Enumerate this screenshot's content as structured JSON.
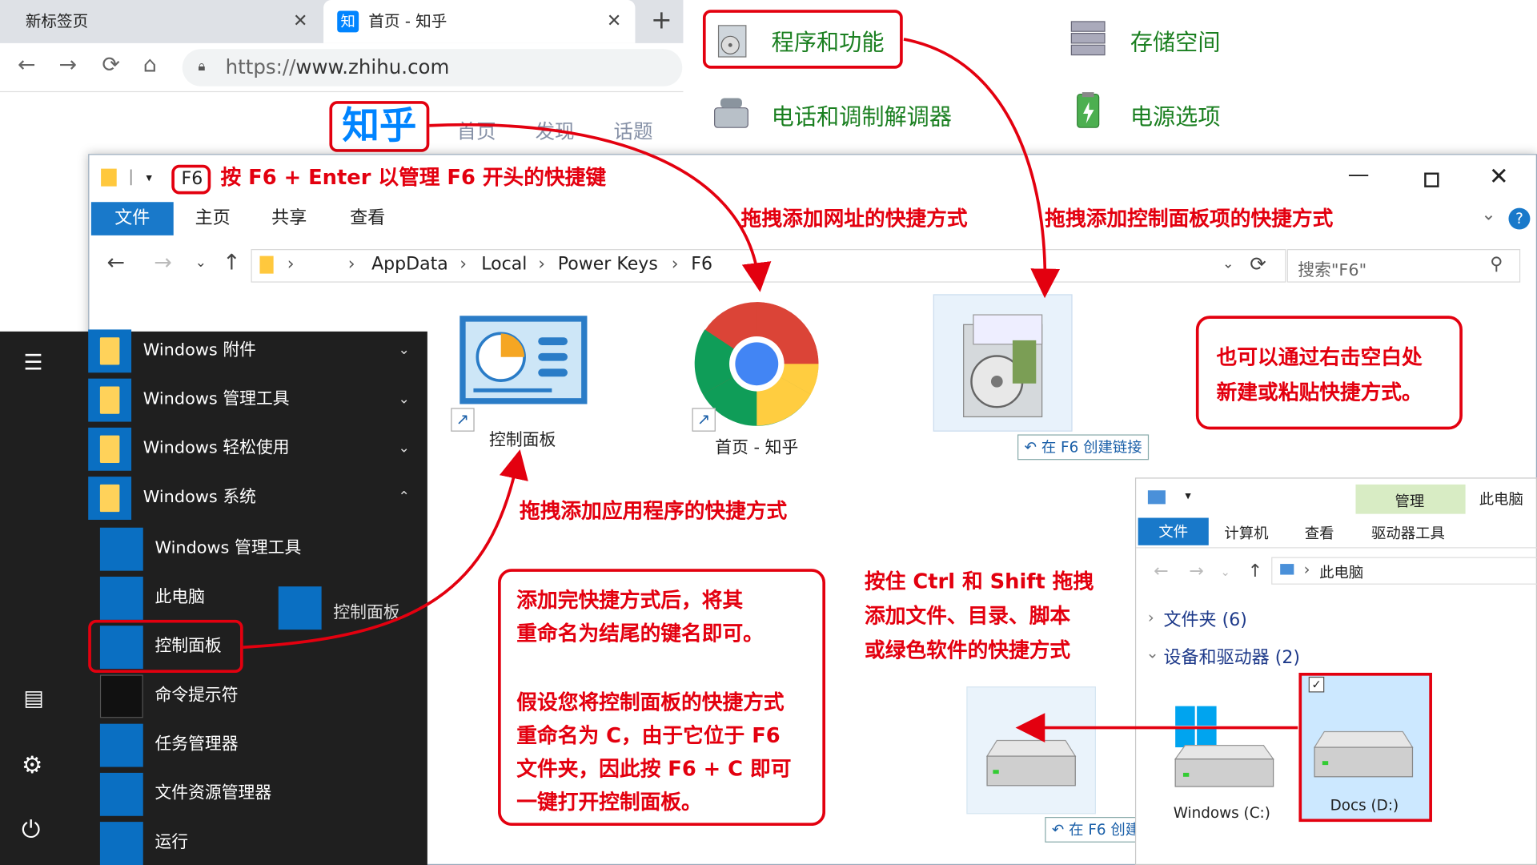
{
  "browser": {
    "tab1_title": "新标签页",
    "tab2_title": "首页 - 知乎",
    "tab2_favicon": "知",
    "new_tab": "+",
    "url_scheme": "https://",
    "url_host": "www.zhihu.com",
    "zhihu_logo": "知乎",
    "zhihu_nav": [
      "首页",
      "发现",
      "话题"
    ],
    "close_glyph": "✕"
  },
  "control_panel": {
    "items": [
      "程序和功能",
      "存储空间",
      "电话和调制解调器",
      "电源选项"
    ]
  },
  "explorer": {
    "f6_badge": "F6",
    "header_note": "按 F6 + Enter 以管理 F6 开头的快捷键",
    "ribbon_tabs": [
      "文件",
      "主页",
      "共享",
      "查看"
    ],
    "breadcrumb": [
      "AppData",
      "Local",
      "Power Keys",
      "F6"
    ],
    "search_placeholder": "搜索\"F6\"",
    "files": [
      "控制面板",
      "首页 - 知乎"
    ],
    "create_link": "在 F6 创建链接"
  },
  "start_menu": {
    "folders": [
      "Windows 附件",
      "Windows 管理工具",
      "Windows 轻松使用",
      "Windows 系统"
    ],
    "apps": [
      "Windows 管理工具",
      "此电脑",
      "控制面板",
      "命令提示符",
      "任务管理器",
      "文件资源管理器",
      "运行"
    ],
    "drag_ghost": "控制面板"
  },
  "notes": {
    "drag_url": "拖拽添加网址的快捷方式",
    "drag_cp": "拖拽添加控制面板项的快捷方式",
    "drag_app": "拖拽添加应用程序的快捷方式",
    "right_click": [
      "也可以通过右击空白处",
      "新建或粘贴快捷方式。"
    ],
    "rename": [
      "添加完快捷方式后，将其",
      "重命名为结尾的键名即可。",
      "",
      "假设您将控制面板的快捷方式",
      "重命名为 C，由于它位于 F6",
      "文件夹，因此按 F6 + C 即可",
      "一键打开控制面板。"
    ],
    "ctrl_shift": [
      "按住 Ctrl 和 Shift 拖拽",
      "添加文件、目录、脚本",
      "或绿色软件的快捷方式"
    ]
  },
  "this_pc": {
    "title": "此电脑",
    "ribbon_tabs": [
      "文件",
      "计算机",
      "查看"
    ],
    "manage_tab": "管理",
    "drive_tools": "驱动器工具",
    "address": "此电脑",
    "groups": [
      "文件夹 (6)",
      "设备和驱动器 (2)"
    ],
    "drives": [
      "Windows (C:)",
      "Docs (D:)"
    ]
  },
  "colors": {
    "annotation_red": "#e3000f",
    "cp_green": "#1a7f20",
    "win_blue": "#1979ca"
  }
}
